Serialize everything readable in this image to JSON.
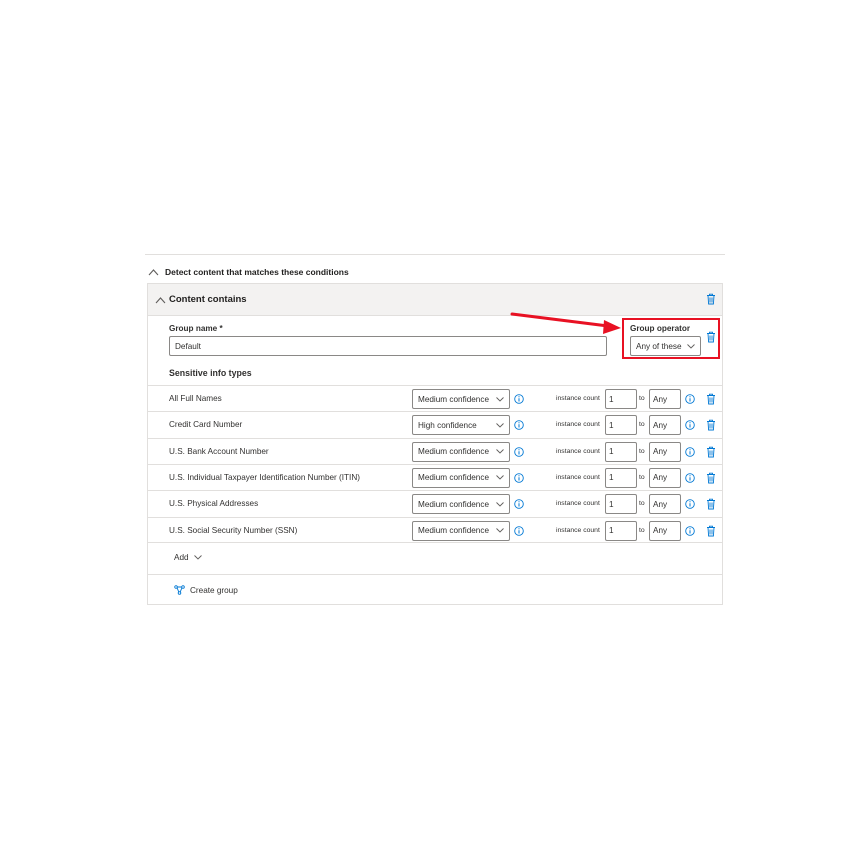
{
  "section": {
    "title": "Detect content that matches these conditions"
  },
  "group": {
    "title": "Content contains",
    "name_label": "Group name *",
    "name_value": "Default",
    "operator_label": "Group operator",
    "operator_value": "Any of these"
  },
  "sensitive_info": {
    "heading": "Sensitive info types",
    "instance_label": "instance count",
    "to_label": "to",
    "rows": [
      {
        "name": "All Full Names",
        "confidence": "Medium confidence",
        "min": "1",
        "max": "Any"
      },
      {
        "name": "Credit Card Number",
        "confidence": "High confidence",
        "min": "1",
        "max": "Any"
      },
      {
        "name": "U.S. Bank Account Number",
        "confidence": "Medium confidence",
        "min": "1",
        "max": "Any"
      },
      {
        "name": "U.S. Individual Taxpayer Identification Number (ITIN)",
        "confidence": "Medium confidence",
        "min": "1",
        "max": "Any"
      },
      {
        "name": "U.S. Physical Addresses",
        "confidence": "Medium confidence",
        "min": "1",
        "max": "Any"
      },
      {
        "name": "U.S. Social Security Number (SSN)",
        "confidence": "Medium confidence",
        "min": "1",
        "max": "Any"
      }
    ]
  },
  "actions": {
    "add_label": "Add",
    "create_group_label": "Create group"
  },
  "icons": {
    "collapse": "chevron-up-icon",
    "delete": "trash-icon",
    "info": "info-icon",
    "dropdown": "chevron-down-icon",
    "create_group": "group-icon"
  },
  "colors": {
    "accent": "#0078d4",
    "annotation": "#e81123",
    "panel_header": "#f3f2f1"
  }
}
